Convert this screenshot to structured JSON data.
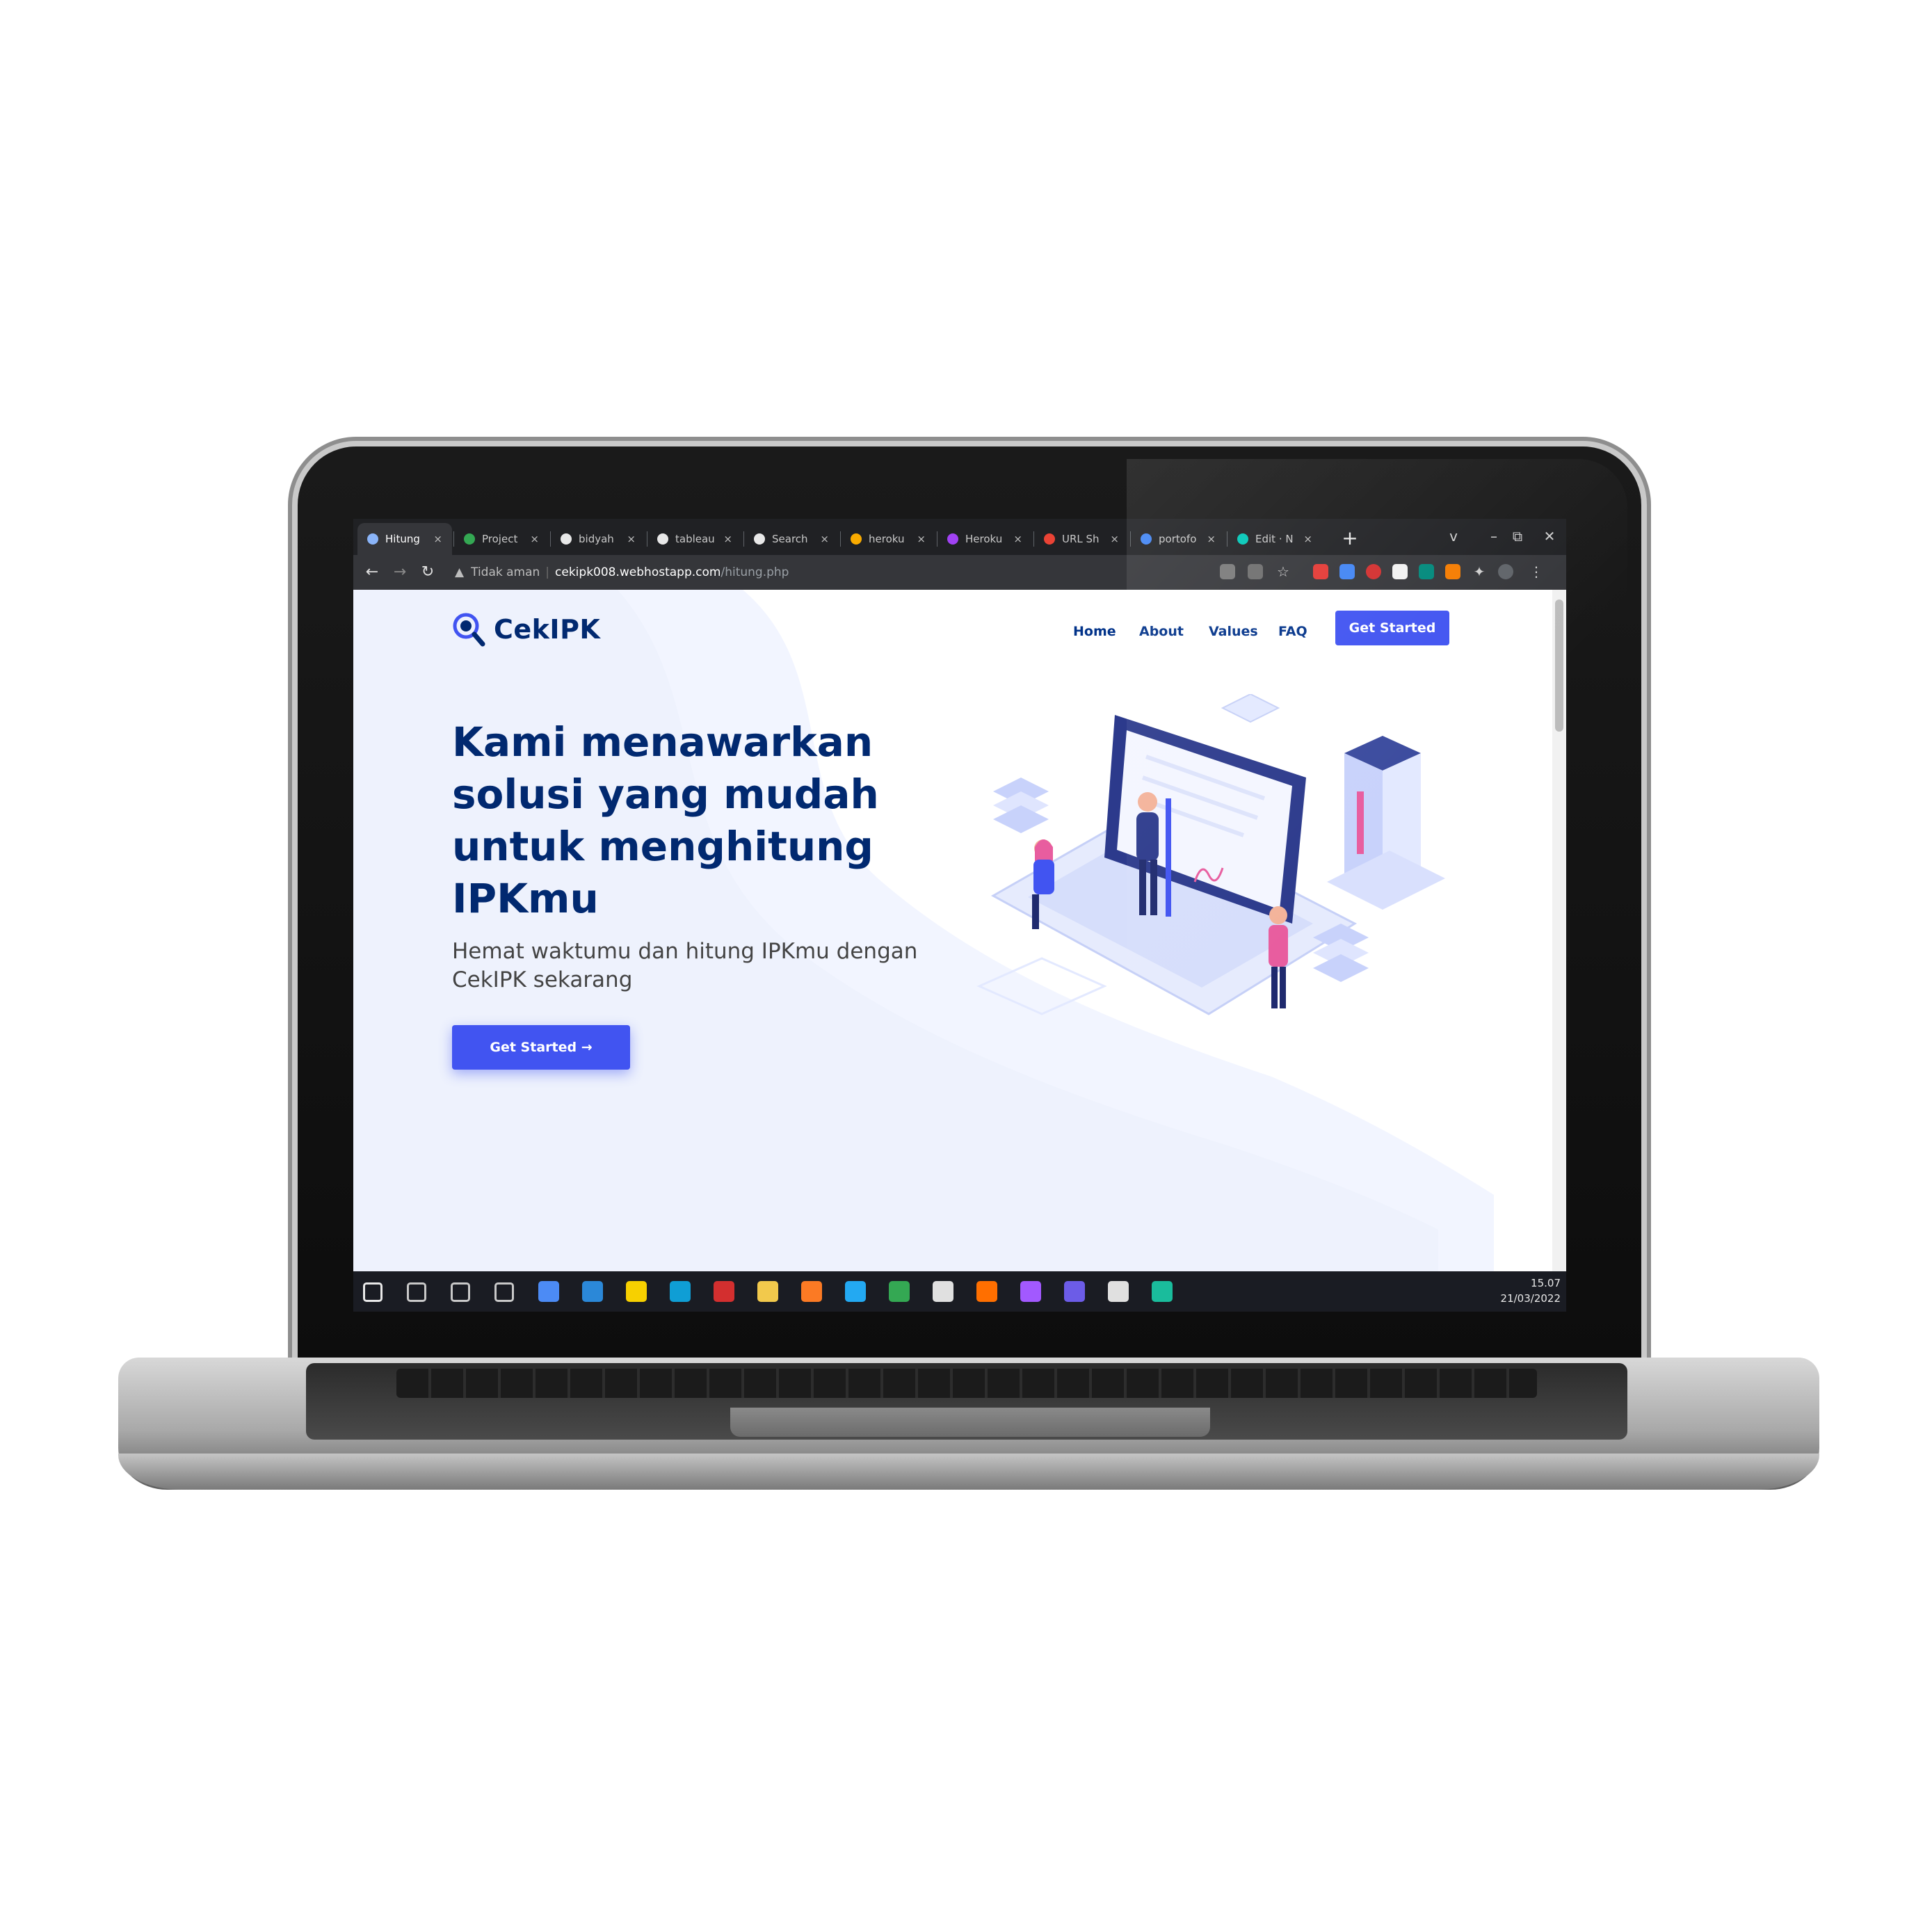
{
  "browser": {
    "tabs": [
      {
        "label": "Hitung",
        "active": true,
        "icon_color": "#8ab4f8"
      },
      {
        "label": "Project",
        "active": false,
        "icon_color": "#34a853"
      },
      {
        "label": "bidyah",
        "active": false,
        "icon_color": "#e8e8e8"
      },
      {
        "label": "tableau",
        "active": false,
        "icon_color": "#e8e8e8"
      },
      {
        "label": "Search",
        "active": false,
        "icon_color": "#e8e8e8"
      },
      {
        "label": "heroku",
        "active": false,
        "icon_color": "#f9ab00"
      },
      {
        "label": "Heroku",
        "active": false,
        "icon_color": "#a142f4"
      },
      {
        "label": "URL Sh",
        "active": false,
        "icon_color": "#ea4335"
      },
      {
        "label": "portofo",
        "active": false,
        "icon_color": "#4285f4"
      },
      {
        "label": "Edit · N",
        "active": false,
        "icon_color": "#00c7b7"
      }
    ],
    "tab_close_glyph": "×",
    "new_tab_glyph": "+",
    "window_controls": [
      "v",
      "–",
      "⧉",
      "✕"
    ],
    "address": {
      "security_label": "Tidak aman",
      "host": "cekipk008.webhostapp.com",
      "path": "/hitung.php"
    }
  },
  "site": {
    "logo_text": "CekIPK",
    "nav": {
      "home": "Home",
      "about": "About",
      "values": "Values",
      "faq": "FAQ",
      "cta": "Get Started"
    },
    "hero": {
      "title": "Kami menawarkan solusi yang mudah untuk menghitung IPKmu",
      "subtitle": "Hemat waktumu dan hitung IPKmu dengan CekIPK sekarang",
      "button": "Get Started →"
    },
    "accent_color": "#4154f1",
    "heading_color": "#012970"
  },
  "taskbar": {
    "clock_time": "15.07",
    "clock_date": "21/03/2022",
    "apps": [
      "windows-start-icon",
      "search-icon",
      "cortana-icon",
      "task-view-icon",
      "media-player-icon",
      "todo-icon",
      "sticky-notes-icon",
      "edge-icon",
      "record-icon",
      "file-explorer-icon",
      "xampp-icon",
      "vscode-icon",
      "chrome-icon",
      "app-icon",
      "illustrator-icon",
      "figma-icon",
      "obs-icon",
      "notepad-icon",
      "git-icon"
    ]
  }
}
